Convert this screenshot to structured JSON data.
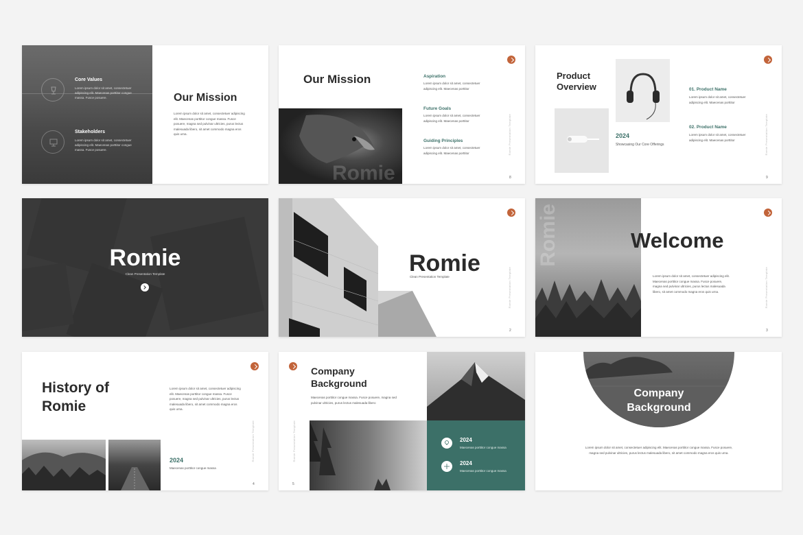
{
  "colors": {
    "accent": "#c2643a",
    "teal": "#3c7068",
    "dark": "#3a3a3a"
  },
  "s1": {
    "core_title": "Core Values",
    "core_text": "Lorem ipsum dolor sit amet, consectetuer adipiscing elit. Maecenas porttitor congue massa. Fusce posuere.",
    "stake_title": "Stakeholders",
    "stake_text": "Lorem ipsum dolor sit amet, consectetuer adipiscing elit. Maecenas porttitor congue massa. Fusce posuere.",
    "title": "Our Mission",
    "body": "Lorem ipsum dolor sit amet, consectetuer adipiscing elit. Maecenas porttitor congue massa. Fusce posuere, magna sed pulvinar ultricies, purus lectus malesuada libero, sit amet commodo magna eros quis urna."
  },
  "s2": {
    "title": "Our Mission",
    "watermark": "Romie",
    "items": [
      {
        "title": "Aspiration",
        "text": "Lorem ipsum dolor sit amet, consectetuer adipiscing elit. Maecenas porttitor"
      },
      {
        "title": "Future Goals",
        "text": "Lorem ipsum dolor sit amet, consectetuer adipiscing elit. Maecenas porttitor"
      },
      {
        "title": "Guiding Principles",
        "text": "Lorem ipsum dolor sit amet, consectetuer adipiscing elit. Maecenas porttitor"
      }
    ],
    "vtext": "Romie Presentation Template",
    "page": "8"
  },
  "s3": {
    "title_line1": "Product",
    "title_line2": "Overview",
    "year": "2024",
    "caption": "Showcasing Our Core Offerings",
    "product1_title": "01. Product Name",
    "product1_text": "Lorem ipsum dolor sit amet, consectetuer adipiscing elit. Maecenas porttitor",
    "product2_title": "02. Product Name",
    "product2_text": "Lorem ipsum dolor sit amet, consectetuer adipiscing elit. Maecenas porttitor",
    "vtext": "Romie Presentation Template",
    "page": "9"
  },
  "s4": {
    "title": "Romie",
    "subtitle": "Clean Presentation Template"
  },
  "s5": {
    "title": "Romie",
    "subtitle": "Clean Presentation Template",
    "vtext": "Romie Presentation Template",
    "page": "2"
  },
  "s6": {
    "watermark": "Romie",
    "title": "Welcome",
    "body": "Lorem ipsum dolor sit amet, consectetuer adipiscing elit. Maecenas porttitor congue massa. Fusce posuere, magna sed pulvinar ultricies, purus lectus malesuada libero, sit amet commodo magna eros quis urna.",
    "vtext": "Romie Presentation Template",
    "page": "3"
  },
  "s7": {
    "title_line1": "History of",
    "title_line2": "Romie",
    "body": "Lorem ipsum dolor sit amet, consectetuer adipiscing elit. Maecenas porttitor congue massa. Fusce posuere, magna sed pulvinar ultricies, purus lectus malesuada libero, sit amet commodo magna eros quis urna.",
    "year": "2024",
    "caption": "Maecenas porttitor congue massa",
    "vtext": "Romie Presentation Template",
    "page": "4"
  },
  "s8": {
    "title_line1": "Company",
    "title_line2": "Background",
    "body": "Maecenas porttitor congue massa. Fusce posuere, magna sed pulvinar ultricies, purus lectus malesuada libero",
    "vtext": "Romie Presentation Template",
    "page": "5",
    "item1_year": "2024",
    "item1_text": "Maecenas porttitor congue massa",
    "item2_year": "2024",
    "item2_text": "Maecenas porttitor congue massa"
  },
  "s9": {
    "title_line1": "Company",
    "title_line2": "Background",
    "body": "Lorem ipsum dolor sit amet, consectetuer adipiscing elit. Maecenas porttitor congue massa. Fusce posuere, magna sed pulvinar ultricies, purus lectus malesuada libero, sit amet commodo magna eros quis urna."
  }
}
